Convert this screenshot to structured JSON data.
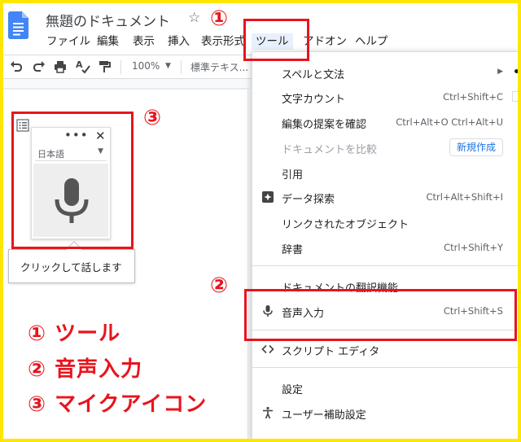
{
  "app": {
    "doc_title": "無題のドキュメント",
    "menus": [
      {
        "label": "ファイル"
      },
      {
        "label": "編集"
      },
      {
        "label": "表示"
      },
      {
        "label": "挿入"
      },
      {
        "label": "表示形式"
      },
      {
        "label": "ツール"
      },
      {
        "label": "アドオン"
      },
      {
        "label": "ヘルプ"
      }
    ]
  },
  "toolbar": {
    "zoom": "100%",
    "style": "標準テキス..."
  },
  "voice_widget": {
    "language": "日本語",
    "tooltip": "クリックして話します"
  },
  "tools_menu": {
    "items": [
      {
        "label": "スペルと文法",
        "shortcut": "",
        "icon": "",
        "submenu": true
      },
      {
        "label": "文字カウント",
        "shortcut": "Ctrl+Shift+C",
        "icon": ""
      },
      {
        "label": "編集の提案を確認",
        "shortcut": "Ctrl+Alt+O Ctrl+Alt+U",
        "icon": ""
      },
      {
        "label": "ドキュメントを比較",
        "shortcut": "",
        "badge": "新規作成",
        "disabled": true
      },
      {
        "label": "引用",
        "shortcut": "",
        "icon": ""
      },
      {
        "label": "データ探索",
        "shortcut": "Ctrl+Alt+Shift+I",
        "icon": "explore-icon"
      },
      {
        "label": "リンクされたオブジェクト",
        "shortcut": "",
        "icon": ""
      },
      {
        "label": "辞書",
        "shortcut": "Ctrl+Shift+Y",
        "icon": ""
      },
      {
        "label": "ドキュメントの翻訳機能",
        "shortcut": "",
        "icon": ""
      },
      {
        "label": "音声入力",
        "shortcut": "Ctrl+Shift+S",
        "icon": "microphone-icon"
      },
      {
        "label": "スクリプト エディタ",
        "shortcut": "",
        "icon": "code-icon"
      },
      {
        "label": "設定",
        "shortcut": "",
        "icon": ""
      },
      {
        "label": "ユーザー補助設定",
        "shortcut": "",
        "icon": "accessibility-icon"
      }
    ]
  },
  "annotations": {
    "num1": "①",
    "num2": "②",
    "num3": "③",
    "legend": [
      "① ツール",
      "② 音声入力",
      "③ マイクアイコン"
    ],
    "accent_color": "#e8141d",
    "frame_color": "#ffe600"
  }
}
